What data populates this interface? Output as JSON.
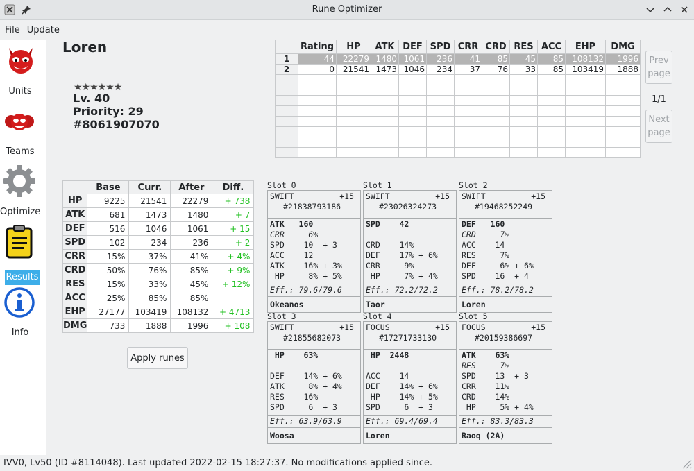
{
  "window": {
    "title": "Rune Optimizer"
  },
  "menu": [
    "File",
    "Update"
  ],
  "sidebar": [
    {
      "label": "Units",
      "icon": "devil-face-icon"
    },
    {
      "label": "Teams",
      "icon": "devil-group-icon"
    },
    {
      "label": "Optimize",
      "icon": "gear-icon"
    },
    {
      "label": "Results",
      "icon": "clipboard-icon",
      "active": true
    },
    {
      "label": "Info",
      "icon": "info-icon"
    }
  ],
  "unit": {
    "name": "Loren",
    "stars": "★★★★★★",
    "level": "Lv. 40",
    "priority": "Priority: 29",
    "id": "#8061907070"
  },
  "results": {
    "headers": [
      "",
      "Rating",
      "HP",
      "ATK",
      "DEF",
      "SPD",
      "CRR",
      "CRD",
      "RES",
      "ACC",
      "EHP",
      "DMG"
    ],
    "rows": [
      [
        "1",
        "44",
        "22279",
        "1480",
        "1061",
        "236",
        "41",
        "85",
        "45",
        "85",
        "108132",
        "1996"
      ],
      [
        "2",
        "0",
        "21541",
        "1473",
        "1046",
        "234",
        "37",
        "76",
        "33",
        "85",
        "103419",
        "1888"
      ]
    ],
    "prev_label": "Prev page",
    "next_label": "Next page",
    "page": "1/1"
  },
  "stats": {
    "headers": [
      "",
      "Base",
      "Curr.",
      "After",
      "Diff."
    ],
    "rows": [
      [
        "HP",
        "9225",
        "21541",
        "22279",
        "+ 738"
      ],
      [
        "ATK",
        "681",
        "1473",
        "1480",
        "+ 7"
      ],
      [
        "DEF",
        "516",
        "1046",
        "1061",
        "+ 15"
      ],
      [
        "SPD",
        "102",
        "234",
        "236",
        "+ 2"
      ],
      [
        "CRR",
        "15%",
        "37%",
        "41%",
        "+ 4%"
      ],
      [
        "CRD",
        "50%",
        "76%",
        "85%",
        "+ 9%"
      ],
      [
        "RES",
        "15%",
        "33%",
        "45%",
        "+ 12%"
      ],
      [
        "ACC",
        "25%",
        "85%",
        "85%",
        ""
      ],
      [
        "EHP",
        "27177",
        "103419",
        "108132",
        "+ 4713"
      ],
      [
        "DMG",
        "733",
        "1888",
        "1996",
        "+ 108"
      ]
    ]
  },
  "apply_label": "Apply runes",
  "slots": [
    {
      "title": "Slot 0",
      "set": "SWIFT",
      "level": "+15",
      "rid": "#21838793186",
      "main": "ATK   160",
      "innate": "CRR     6%",
      "subs": [
        "SPD    10  + 3",
        "ACC    12",
        "ATK    16% + 3%",
        " HP     8% + 5%"
      ],
      "eff": "Eff.: 79.6/79.6",
      "owner": "Okeanos"
    },
    {
      "title": "Slot 1",
      "set": "SWIFT",
      "level": "+15",
      "rid": "#23026324273",
      "main": "SPD    42",
      "innate": "",
      "subs": [
        "CRD    14%",
        "DEF    17% + 6%",
        "CRR     9%",
        " HP     7% + 4%"
      ],
      "eff": "Eff.: 72.2/72.2",
      "owner": "Taor"
    },
    {
      "title": "Slot 2",
      "set": "SWIFT",
      "level": "+15",
      "rid": "#19468252249",
      "main": "DEF   160",
      "innate": "CRD     7%",
      "subs": [
        "ACC    14",
        "RES     7%",
        "DEF     6% + 6%",
        "SPD    16  + 4"
      ],
      "eff": "Eff.: 78.2/78.2",
      "owner": "Loren"
    },
    {
      "title": "Slot 3",
      "set": "SWIFT",
      "level": "+15",
      "rid": "#21855682073",
      "main": " HP    63%",
      "innate": "",
      "subs": [
        "DEF    14% + 6%",
        "ATK     8% + 4%",
        "RES    16%",
        "SPD     6  + 3"
      ],
      "eff": "Eff.: 63.9/63.9",
      "owner": "Woosa"
    },
    {
      "title": "Slot 4",
      "set": "FOCUS",
      "level": "+15",
      "rid": "#17271733130",
      "main": " HP  2448",
      "innate": "",
      "subs": [
        "ACC    14",
        "DEF    14% + 6%",
        " HP    14% + 5%",
        "SPD     6  + 3"
      ],
      "eff": "Eff.: 69.4/69.4",
      "owner": "Loren"
    },
    {
      "title": "Slot 5",
      "set": "FOCUS",
      "level": "+15",
      "rid": "#20159386697",
      "main": "ATK    63%",
      "innate": "RES     7%",
      "subs": [
        "SPD    13  + 3",
        "CRR    11%",
        "CRD    14%",
        " HP     5% + 4%"
      ],
      "eff": "Eff.: 83.3/83.3",
      "owner": "Raoq (2A)"
    }
  ],
  "status": "IVV0, Lv50 (ID #8114048). Last updated 2022-02-15 18:27:37. No modifications applied since."
}
